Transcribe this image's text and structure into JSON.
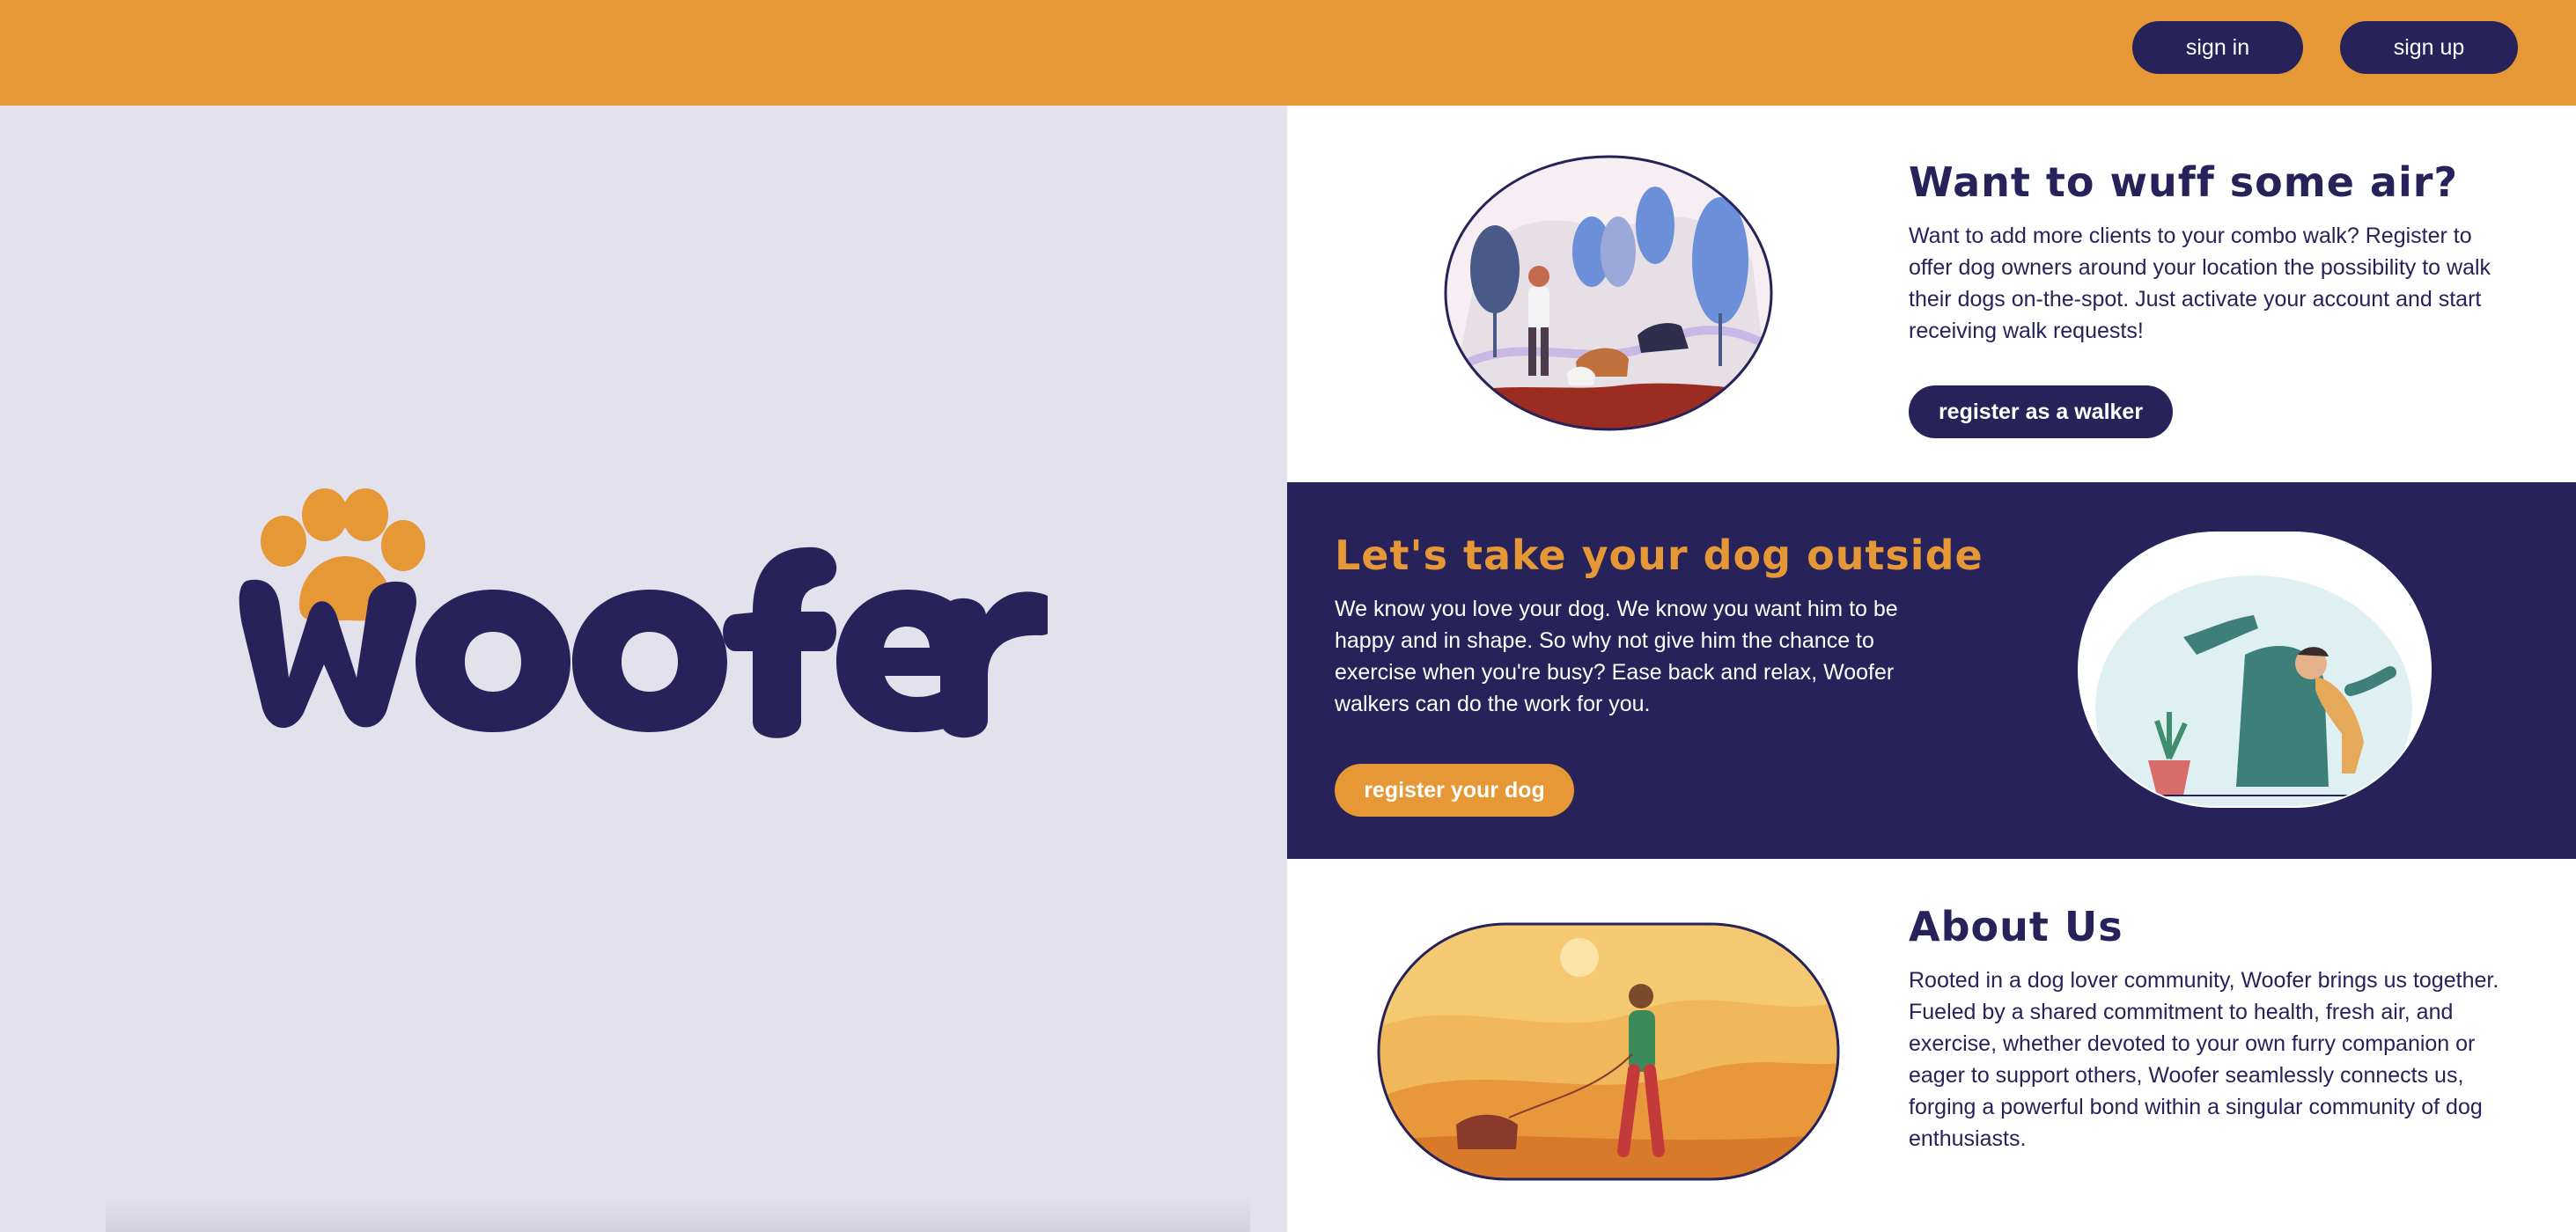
{
  "header": {
    "sign_in_label": "sign in",
    "sign_up_label": "sign up"
  },
  "brand": {
    "logo_text": "Woofer",
    "colors": {
      "orange": "#e59835",
      "navy": "#27225a",
      "lavender": "#e3e1ec"
    }
  },
  "sections": {
    "walker": {
      "title": "Want to wuff some air?",
      "text": "Want to add more clients to your combo walk? Register to offer dog owners around your location the possibility to walk their dogs on-the-spot. Just activate your account and start receiving walk requests!",
      "button_label": "register as a walker"
    },
    "owner": {
      "title": "Let's take your dog outside",
      "text": "We know you love your dog. We know you want him to be happy and in shape. So why not give him the chance to exercise when you're busy? Ease back and relax, Woofer walkers can do the work for you.",
      "button_label": "register your dog"
    },
    "about": {
      "title": "About Us",
      "text": "Rooted in a dog lover community, Woofer brings us together. Fueled by a shared commitment to health, fresh air, and exercise, whether devoted to your own furry companion or eager to support others, Woofer seamlessly connects us, forging a powerful bond within a singular community of dog enthusiasts."
    }
  }
}
